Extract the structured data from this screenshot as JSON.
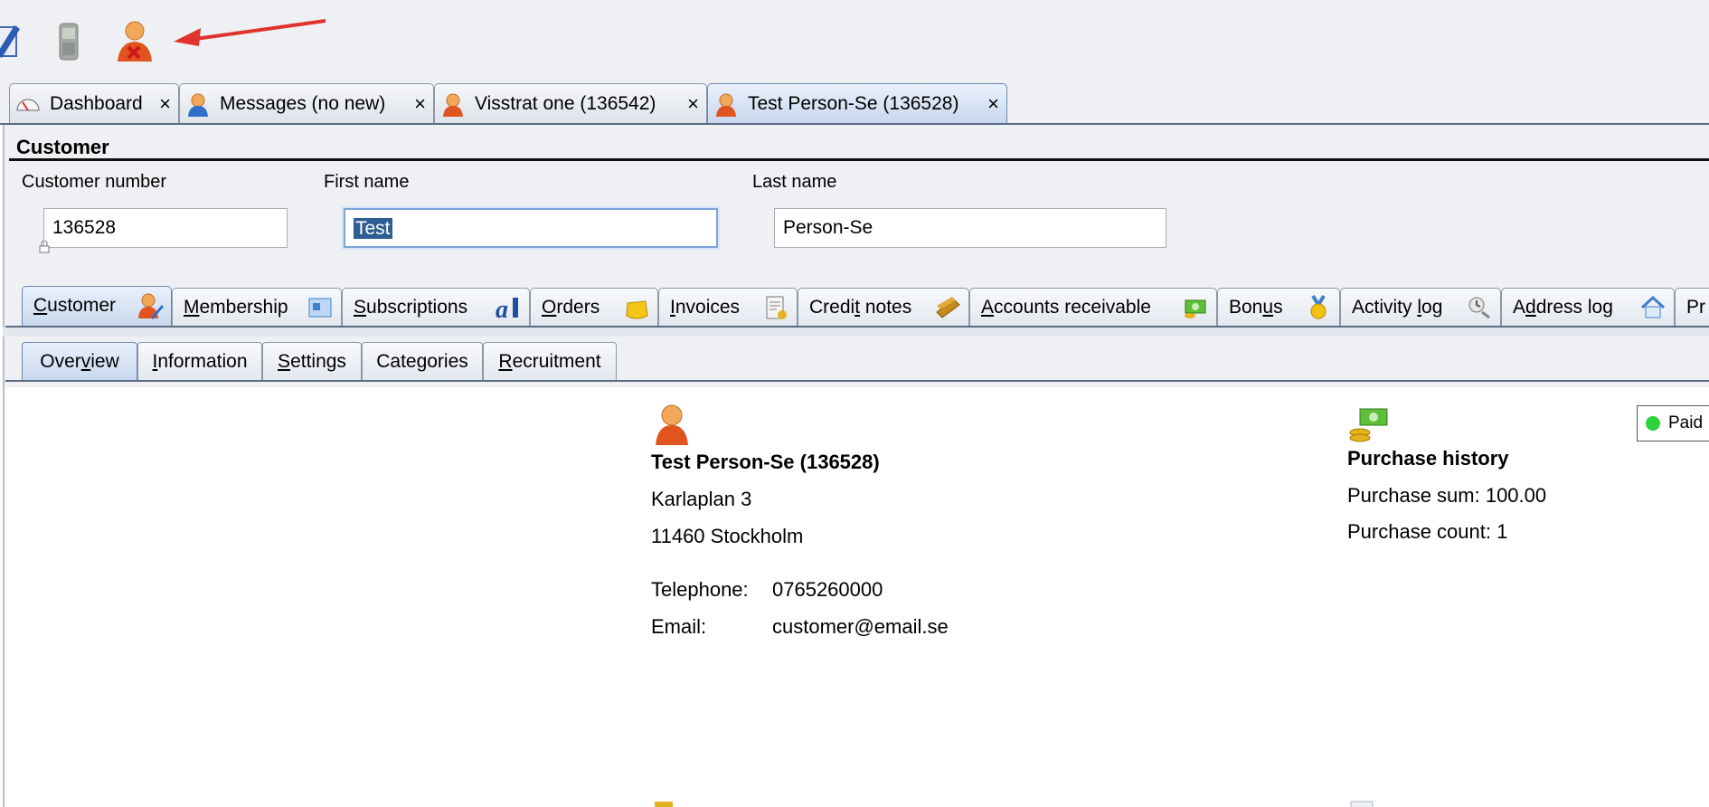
{
  "toolbar": {
    "icons": [
      "compose-icon",
      "mobile-phone-icon",
      "person-remove-icon"
    ],
    "annotation": "red-arrow"
  },
  "doc_tabs": [
    {
      "label": "Dashboard",
      "icon": "gauge-icon",
      "active": false
    },
    {
      "label": "Messages (no new)",
      "icon": "person-message-icon",
      "active": false
    },
    {
      "label": "Visstrat one (136542)",
      "icon": "person-icon",
      "active": false
    },
    {
      "label": "Test Person-Se (136528)",
      "icon": "person-icon",
      "active": true
    }
  ],
  "close_glyph": "×",
  "customer": {
    "section_title": "Customer",
    "fields": {
      "customer_number": {
        "label": "Customer number",
        "value": "136528"
      },
      "first_name": {
        "label": "First name",
        "value": "Test"
      },
      "last_name": {
        "label": "Last name",
        "value": "Person-Se"
      }
    }
  },
  "module_tabs": [
    {
      "label": "Customer",
      "mnemonic": "C",
      "icon": "person-edit-icon",
      "active": true
    },
    {
      "label": "Membership",
      "mnemonic": "M",
      "icon": "membership-card-icon",
      "active": false
    },
    {
      "label": "Subscriptions",
      "mnemonic": "S",
      "icon": "subscription-a-icon",
      "active": false
    },
    {
      "label": "Orders",
      "mnemonic": "O",
      "icon": "orders-bag-icon",
      "active": false
    },
    {
      "label": "Invoices",
      "mnemonic": "I",
      "icon": "invoice-document-icon",
      "active": false
    },
    {
      "label": "Credit notes",
      "mnemonic": "t",
      "icon": "credit-notes-icon",
      "active": false
    },
    {
      "label": "Accounts receivable",
      "mnemonic": "A",
      "icon": "money-stack-icon",
      "active": false
    },
    {
      "label": "Bonus",
      "mnemonic": "u",
      "icon": "medal-icon",
      "active": false
    },
    {
      "label": "Activity log",
      "mnemonic": "l",
      "icon": "activity-log-icon",
      "active": false
    },
    {
      "label": "Address log",
      "mnemonic": "d",
      "icon": "house-icon",
      "active": false
    },
    {
      "label": "Pr",
      "mnemonic": "",
      "icon": "",
      "active": false
    }
  ],
  "sub_tabs": [
    {
      "label": "Overview",
      "active": true
    },
    {
      "label": "Information",
      "active": false
    },
    {
      "label": "Settings",
      "active": false
    },
    {
      "label": "Categories",
      "active": false
    },
    {
      "label": "Recruitment",
      "active": false
    }
  ],
  "overview": {
    "name": "Test Person-Se (136528)",
    "street": "Karlaplan 3",
    "postal": "11460 Stockholm",
    "telephone_label": "Telephone:",
    "telephone": "0765260000",
    "email_label": "Email:",
    "email": "customer@email.se",
    "purchase_history": {
      "title": "Purchase history",
      "sum": "Purchase sum: 100.00",
      "count": "Purchase count: 1"
    },
    "badge": {
      "label": "Paid",
      "color": "#2bd43a"
    }
  },
  "colors": {
    "accent_selection": "#2d5d92",
    "arrow": "#e0332e",
    "focus_border": "#7aa5d8"
  }
}
